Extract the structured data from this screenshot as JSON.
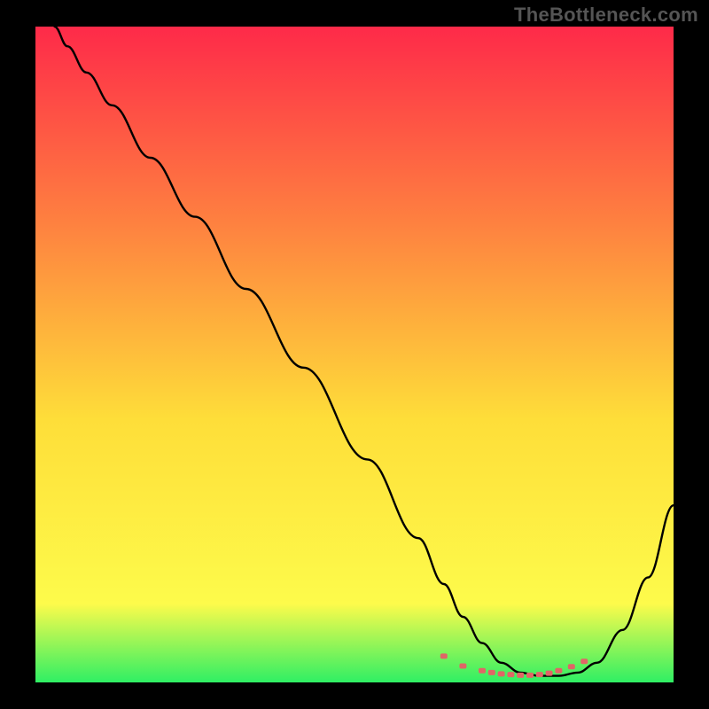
{
  "watermark": "TheBottleneck.com",
  "colors": {
    "background": "#000000",
    "curve_stroke": "#000000",
    "marker_stroke": "#e06666",
    "marker_fill": "#e06666",
    "gradient_top": "#fe2a49",
    "gradient_mid_upper": "#fe8140",
    "gradient_mid": "#fede39",
    "gradient_mid_lower": "#fdfb4b",
    "gradient_bottom": "#2fef64"
  },
  "chart_data": {
    "type": "line",
    "title": "",
    "xlabel": "",
    "ylabel": "",
    "xlim": [
      0,
      100
    ],
    "ylim": [
      0,
      100
    ],
    "grid": false,
    "legend": false,
    "series": [
      {
        "name": "curve",
        "x": [
          3,
          5,
          8,
          12,
          18,
          25,
          33,
          42,
          52,
          60,
          64,
          67,
          70,
          73,
          76,
          79,
          82,
          85,
          88,
          92,
          96,
          100
        ],
        "values": [
          100,
          97,
          93,
          88,
          80,
          71,
          60,
          48,
          34,
          22,
          15,
          10,
          6,
          3,
          1.5,
          1,
          1,
          1.5,
          3,
          8,
          16,
          27
        ]
      }
    ],
    "markers": {
      "name": "highlighted-minimum",
      "x": [
        64,
        67,
        70,
        71.5,
        73,
        74.5,
        76,
        77.5,
        79,
        80.5,
        82,
        84,
        86
      ],
      "values": [
        4,
        2.5,
        1.8,
        1.5,
        1.3,
        1.2,
        1.1,
        1.1,
        1.2,
        1.4,
        1.8,
        2.4,
        3.2
      ]
    }
  }
}
